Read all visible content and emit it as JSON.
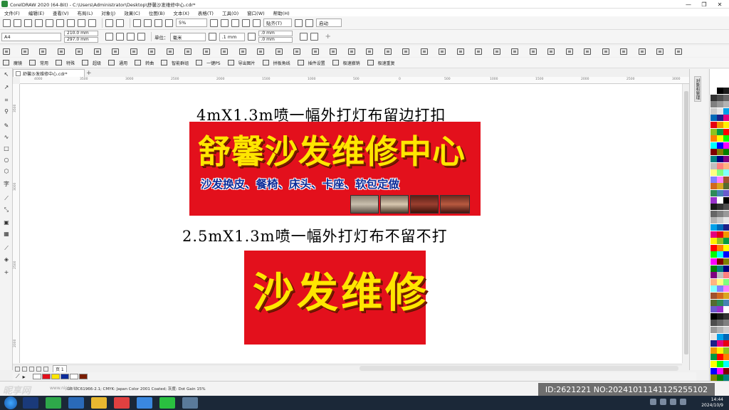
{
  "window": {
    "title": "CorelDRAW 2020 (64-Bit) - C:\\Users\\Administrator\\Desktop\\舒馨沙发维修中心.cdr*",
    "controls": [
      "—",
      "❐",
      "✕"
    ]
  },
  "menu": {
    "items": [
      "文件(F)",
      "编辑(E)",
      "查看(V)",
      "布局(L)",
      "对象(J)",
      "效果(C)",
      "位图(B)",
      "文本(X)",
      "表格(T)",
      "工具(O)",
      "窗口(W)",
      "帮助(H)"
    ]
  },
  "toolbar": {
    "zoom": "5%",
    "snap": "贴齐(T)",
    "launch": "启动"
  },
  "property_bar": {
    "page_size": "A4",
    "width": "210.0 mm",
    "height": "297.0 mm",
    "units_label": "单位：",
    "units": "毫米",
    "nudge": ".1 mm",
    "dup_x": ".0 mm",
    "dup_y": ".0 mm"
  },
  "plugin_bar": {
    "items": [
      "魔镜",
      "常用",
      "特殊",
      "超级",
      "通用",
      "转曲",
      "智能群组",
      "一键PS",
      "导出图片",
      "拼板角线",
      "插件设置",
      "极速撤销",
      "极速重复"
    ]
  },
  "document": {
    "tab": "舒馨沙发维修中心.cdr*"
  },
  "ruler": {
    "h_ticks": [
      "4000",
      "3500",
      "3000",
      "2500",
      "2000",
      "1500",
      "1000",
      "500",
      "0",
      "500",
      "1000",
      "1500",
      "2000",
      "2500",
      "3000"
    ],
    "v_ticks": [
      "3500",
      "3000",
      "2500",
      "2000"
    ]
  },
  "canvas": {
    "line1": "4mX1.3m喷一幅外打灯布留边打扣",
    "banner1_title": "舒馨沙发维修中心",
    "banner1_sub": "沙发换皮、餐椅、床头、卡座、软包定做",
    "line2": "2.5mX1.3m喷一幅外打灯布不留不打",
    "banner2_title": "沙发维修"
  },
  "pagebar": {
    "page": "页 1"
  },
  "status": {
    "profile": "GB IEC61966-2.1; CMYK: Japan Color 2001 Coated; 灰度: Dot Gain 15%",
    "watermark": "昵享网",
    "site": "www.nipic.cn"
  },
  "overlay": {
    "id_text": "ID:2621221 NO:20241011141125255102"
  },
  "dock": {
    "tab": "对象和管理"
  },
  "taskbar": {
    "time": "14:44",
    "date": "2024/10/9"
  },
  "colors": {
    "banner_red": "#e3101c",
    "banner_yellow": "#ffe600",
    "sub_blue": "#0d2c9a"
  }
}
